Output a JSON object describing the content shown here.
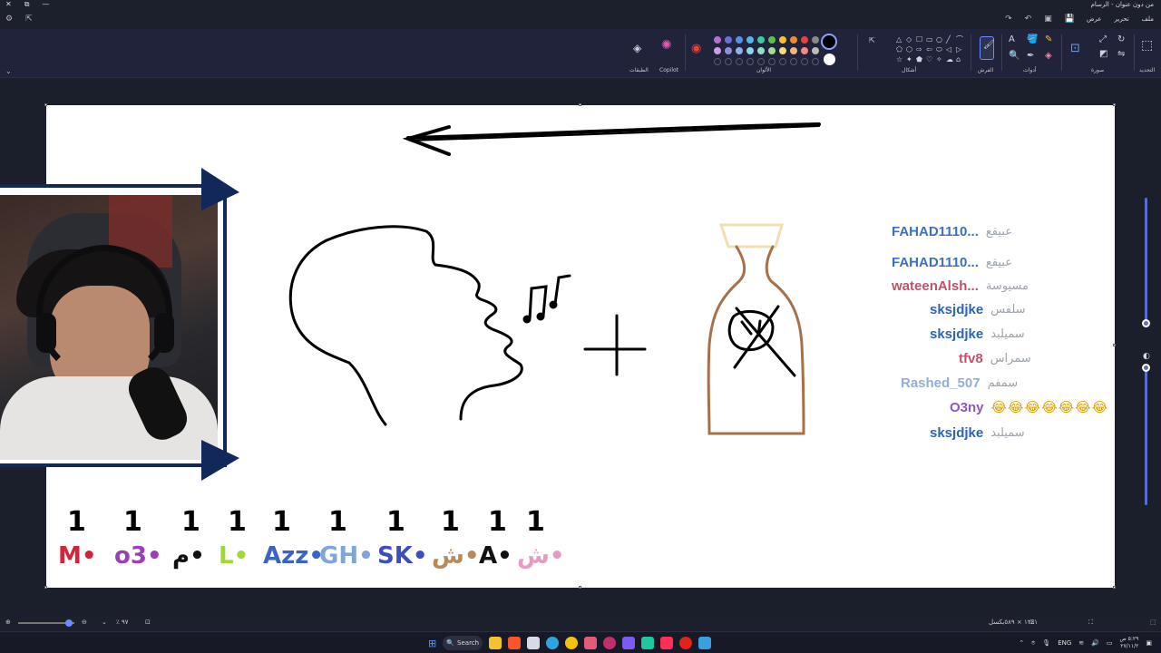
{
  "window": {
    "title": "من دون عنوان - الرسام",
    "controls": [
      "✕",
      "⧉",
      "—"
    ]
  },
  "menu": {
    "items": [
      "ملف",
      "تحرير",
      "عرض"
    ],
    "quick_icons": [
      "save-icon",
      "new-icon",
      "undo-icon",
      "redo-icon"
    ]
  },
  "ribbon": {
    "groups": {
      "selection": "التحديد",
      "image": "صورة",
      "tools": "أدوات",
      "brushes": "الفرش",
      "shapes": "أشكال",
      "colors": "الألوان",
      "copilot": "Copilot",
      "layers": "الطبقات"
    },
    "palette_colors": [
      "#b46fd1",
      "#6a6fd8",
      "#5c8de8",
      "#4fb7e8",
      "#3ec9a0",
      "#57c34a",
      "#f2c230",
      "#f08a2a",
      "#e8413c",
      "#888888",
      "#c9a0e0",
      "#8c8fe0",
      "#8fb0f0",
      "#8fd5f0",
      "#8fe0c8",
      "#a0e08f",
      "#f5dc7a",
      "#f5b47a",
      "#f08a8a",
      "#bbbbbb",
      "",
      "",
      "",
      "",
      "",
      "",
      "",
      "",
      "",
      ""
    ],
    "primary_color": "#000000",
    "secondary_color": "#ffffff"
  },
  "chat": {
    "messages": [
      {
        "user": "FAHAD1110...",
        "message": "عبيقع",
        "color": "#3b6fc0"
      },
      {
        "user": "FAHAD1110...",
        "message": "عبيقع",
        "color": "#3b6fc0"
      },
      {
        "user": "wateenAlsh...",
        "message": "مسيوسة",
        "color": "#c0506a"
      },
      {
        "user": "sksjdjke",
        "message": "سلفس",
        "color": "#2d63b8"
      },
      {
        "user": "sksjdjke",
        "message": "سميلبد",
        "color": "#2d63b8"
      },
      {
        "user": "tfv8",
        "message": "سمراس",
        "color": "#c8506a"
      },
      {
        "user": "Rashed_507",
        "message": "سمفم",
        "color": "#93aed8"
      },
      {
        "user": "O3ny",
        "message": "😂😂😂😂😂😂😂",
        "color": "#8a57c7"
      },
      {
        "user": "sksjdjke",
        "message": "سميلبد",
        "color": "#2d63b8"
      }
    ]
  },
  "scoreboard": {
    "entries": [
      {
        "score": "1",
        "label": "M•",
        "color": "#d4243a"
      },
      {
        "score": "1",
        "label": "o3•",
        "color": "#9a3fb8"
      },
      {
        "score": "1",
        "label": "م•",
        "color": "#111111"
      },
      {
        "score": "1",
        "label": "L•",
        "color": "#9fd934"
      },
      {
        "score": "1",
        "label": "Azz•",
        "color": "#3a63c4"
      },
      {
        "score": "1",
        "label": "GH•",
        "color": "#7fa6d6"
      },
      {
        "score": "1",
        "label": "SK•",
        "color": "#3d4ec0"
      },
      {
        "score": "1",
        "label": "ش•",
        "color": "#b88a5a"
      },
      {
        "score": "1",
        "label": "A•",
        "color": "#111111"
      },
      {
        "score": "1",
        "label": "ش•",
        "color": "#e79bc4"
      }
    ]
  },
  "statusbar": {
    "zoom": "٪ ٩٧",
    "canvas_size": "١٢٤١ × ٥٨٩بكسل"
  },
  "taskbar": {
    "search_label": "Search",
    "language": "ENG",
    "time": "٥:٢٩ ص",
    "date": "٢٧/١١/٢"
  }
}
